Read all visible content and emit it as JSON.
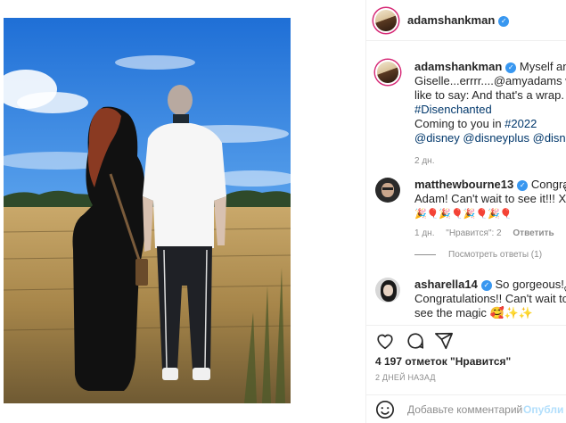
{
  "post": {
    "author": "adamshankman"
  },
  "caption": {
    "author": "adamshankman",
    "line1": "Myself and",
    "line2": "Giselle...errrr....@amyadams would",
    "line3": "like to say: And that's a wrap.",
    "hashtag1": "#Disenchanted",
    "line5_prefix": "Coming to you in ",
    "hashtag2": "#2022",
    "line6": "@disney @disneyplus @disneystu",
    "time": "2 дн."
  },
  "comments": [
    {
      "author": "matthewbourne13",
      "line1": "Congrats",
      "line2": "Adam! Can't wait to see it!!! Xxx",
      "line3": "🎉🎈🎉🎈🎉🎈🎉🎈",
      "time": "1 дн.",
      "likes": "\"Нравится\": 2",
      "reply": "Ответить"
    },
    {
      "author": "asharella14",
      "line1": "So gorgeous!",
      "line2": "Congratulations!! Can't wait to",
      "line3": "see the magic 🥰✨✨"
    }
  ],
  "view_replies": "Посмотреть ответы (1)",
  "likes_text": "4 197 отметок \"Нравится\"",
  "post_date": "2 ДНЕЙ НАЗАД",
  "add_comment": {
    "placeholder": "Добавьте комментарий...",
    "post_label": "Опубли"
  },
  "icons": {
    "verified": "verified-badge-icon",
    "like": "heart-icon",
    "comment": "comment-bubble-icon",
    "share": "paper-plane-icon",
    "emoji": "smiley-icon"
  },
  "colors": {
    "link": "#00376b",
    "verified": "#3897f0",
    "muted": "#8e8e8e",
    "post_disabled": "#b2dffc"
  }
}
